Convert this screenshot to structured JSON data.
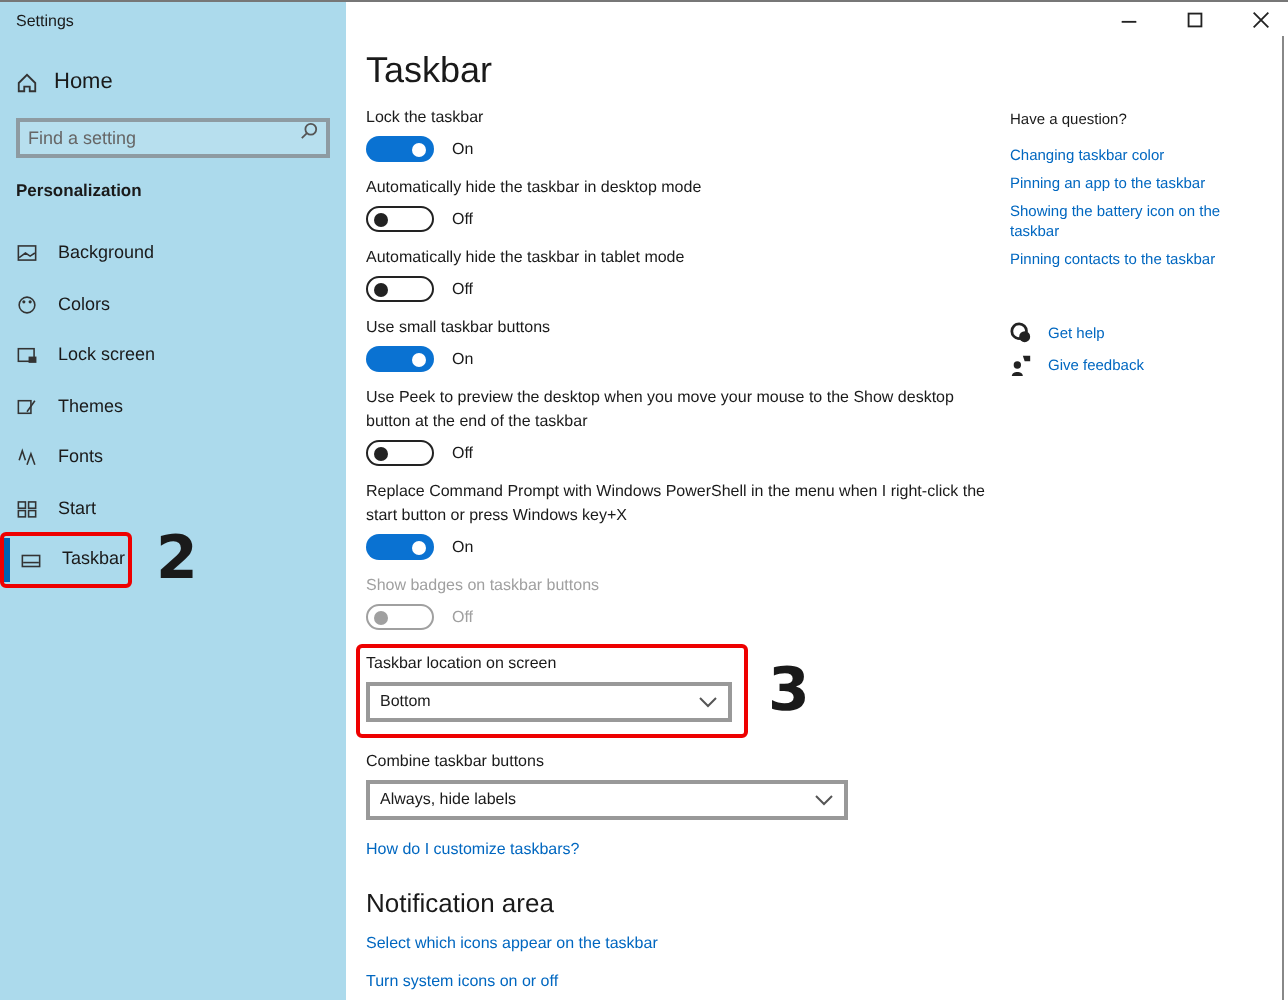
{
  "window": {
    "title": "Settings"
  },
  "sidebar": {
    "home": "Home",
    "search": {
      "placeholder": "Find a setting"
    },
    "section": "Personalization",
    "items": [
      {
        "label": "Background",
        "selected": false
      },
      {
        "label": "Colors",
        "selected": false
      },
      {
        "label": "Lock screen",
        "selected": false
      },
      {
        "label": "Themes",
        "selected": false
      },
      {
        "label": "Fonts",
        "selected": false
      },
      {
        "label": "Start",
        "selected": false
      },
      {
        "label": "Taskbar",
        "selected": true,
        "callout": "2"
      }
    ]
  },
  "main": {
    "title": "Taskbar",
    "settings": [
      {
        "kind": "toggle",
        "label": "Lock the taskbar",
        "on": true,
        "state": "On",
        "disabled": false
      },
      {
        "kind": "toggle",
        "label": "Automatically hide the taskbar in desktop mode",
        "on": false,
        "state": "Off",
        "disabled": false
      },
      {
        "kind": "toggle",
        "label": "Automatically hide the taskbar in tablet mode",
        "on": false,
        "state": "Off",
        "disabled": false
      },
      {
        "kind": "toggle",
        "label": "Use small taskbar buttons",
        "on": true,
        "state": "On",
        "disabled": false
      },
      {
        "kind": "toggle",
        "label": "Use Peek to preview the desktop when you move your mouse to the Show desktop button at the end of the taskbar",
        "on": false,
        "state": "Off",
        "disabled": false
      },
      {
        "kind": "toggle",
        "label": "Replace Command Prompt with Windows PowerShell in the menu when I right-click the start button or press Windows key+X",
        "on": true,
        "state": "On",
        "disabled": false
      },
      {
        "kind": "toggle",
        "label": "Show badges on taskbar buttons",
        "on": false,
        "state": "Off",
        "disabled": true
      },
      {
        "kind": "dropdown",
        "label": "Taskbar location on screen",
        "value": "Bottom",
        "wide": false,
        "callout": "3"
      },
      {
        "kind": "dropdown",
        "label": "Combine taskbar buttons",
        "value": "Always, hide labels",
        "wide": true
      },
      {
        "kind": "link",
        "label": "How do I customize taskbars?"
      },
      {
        "kind": "heading",
        "label": "Notification area"
      },
      {
        "kind": "link",
        "label": "Select which icons appear on the taskbar"
      },
      {
        "kind": "link",
        "label": "Turn system icons on or off"
      }
    ]
  },
  "help": {
    "title": "Have a question?",
    "links": [
      "Changing taskbar color",
      "Pinning an app to the taskbar",
      "Showing the battery icon on the taskbar",
      "Pinning contacts to the taskbar"
    ],
    "actions": [
      "Get help",
      "Give feedback"
    ]
  }
}
